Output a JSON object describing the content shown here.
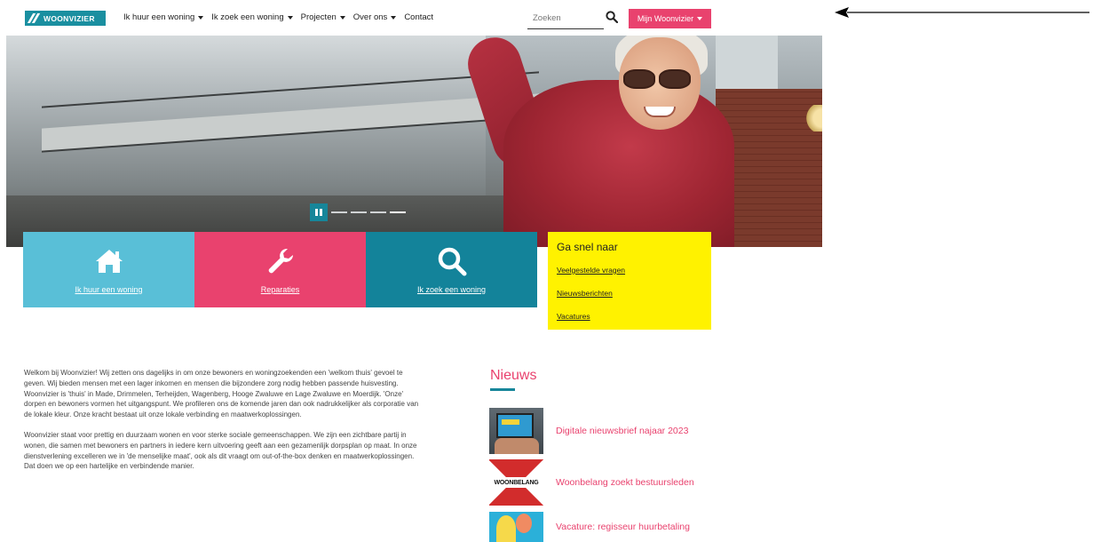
{
  "brand": {
    "logo_text": "WOONVIZIER",
    "accent": "#e9426e",
    "teal": "#13839a",
    "light_blue": "#59bfd7",
    "yellow": "#fff200"
  },
  "nav": {
    "items": [
      {
        "label": "Ik huur een woning",
        "dropdown": true
      },
      {
        "label": "Ik zoek een woning",
        "dropdown": true
      },
      {
        "label": "Projecten",
        "dropdown": true
      },
      {
        "label": "Over ons",
        "dropdown": true
      },
      {
        "label": "Contact",
        "dropdown": false
      }
    ]
  },
  "search": {
    "placeholder": "Zoeken",
    "icon": "search-icon"
  },
  "account": {
    "label": "Mijn Woonvizier"
  },
  "carousel": {
    "slides": 4,
    "active_slide": 4
  },
  "tiles": [
    {
      "label": "Ik huur een woning",
      "icon": "house-icon"
    },
    {
      "label": "Reparaties",
      "icon": "wrench-icon"
    },
    {
      "label": "Ik zoek een woning",
      "icon": "search-icon"
    }
  ],
  "quick_links": {
    "title": "Ga snel naar",
    "links": [
      "Veelgestelde vragen",
      "Nieuwsberichten",
      "Vacatures"
    ]
  },
  "intro": {
    "p1": "Welkom bij Woonvizier! Wij zetten ons dagelijks in om onze bewoners en woningzoekenden een 'welkom thuis' gevoel te geven. Wij bieden mensen met een lager inkomen en mensen die bijzondere zorg nodig hebben passende huisvesting. Woonvizier is 'thuis' in Made, Drimmelen, Terheijden, Wagenberg, Hooge Zwaluwe en Lage Zwaluwe en Moerdijk. 'Onze' dorpen en bewoners vormen het uitgangspunt. We profileren ons de komende jaren dan ook nadrukkelijker als corporatie van de lokale kleur. Onze kracht bestaat uit onze lokale verbinding en maatwerkoplossingen.",
    "p2": "Woonvizier staat voor prettig en duurzaam wonen en voor sterke sociale gemeenschappen. We zijn een zichtbare partij in wonen, die samen met bewoners en partners in iedere kern uitvoering geeft aan een gezamenlijk dorpsplan op maat. In onze dienstverlening excelleren we in 'de menselijke maat', ook als dit vraagt om out-of-the-box denken en maatwerkoplossingen. Dat doen we op een hartelijke en verbindende manier."
  },
  "news": {
    "title": "Nieuws",
    "items": [
      {
        "title": "Digitale nieuwsbrief najaar 2023"
      },
      {
        "title": "Woonbelang zoekt bestuursleden",
        "thumb_text": "WOONBELANG"
      },
      {
        "title": "Vacature: regisseur huurbetaling"
      }
    ]
  }
}
